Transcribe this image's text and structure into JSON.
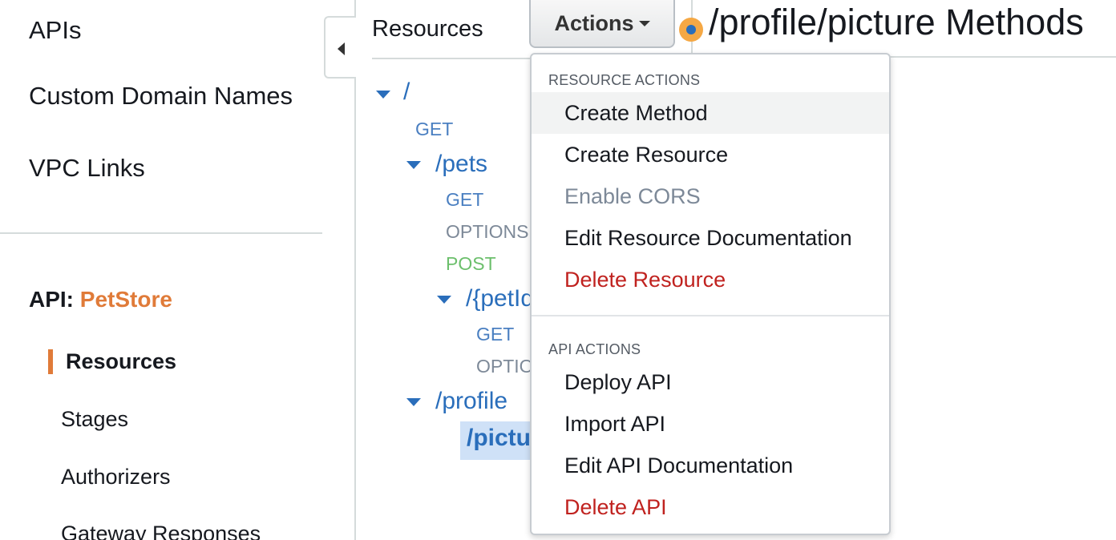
{
  "left_nav": {
    "top_items": [
      "APIs",
      "Custom Domain Names",
      "VPC Links"
    ],
    "api_label": "API:",
    "api_name": "PetStore",
    "sub_items": [
      "Resources",
      "Stages",
      "Authorizers",
      "Gateway Responses"
    ],
    "active_item": "Resources"
  },
  "resources_panel": {
    "title": "Resources",
    "tree": {
      "root": "/",
      "root_methods": [
        "GET"
      ],
      "pets": "/pets",
      "pets_methods": [
        "GET",
        "OPTIONS",
        "POST"
      ],
      "petid": "/{petId}",
      "petid_methods": [
        "GET",
        "OPTIONS"
      ],
      "profile": "/profile",
      "picture": "/picture"
    }
  },
  "actions_button": {
    "label": "Actions"
  },
  "page_header": {
    "title": "/profile/picture Methods"
  },
  "dropdown": {
    "resource_heading": "RESOURCE ACTIONS",
    "resource_actions": [
      "Create Method",
      "Create Resource",
      "Enable CORS",
      "Edit Resource Documentation",
      "Delete Resource"
    ],
    "api_heading": "API ACTIONS",
    "api_actions": [
      "Deploy API",
      "Import API",
      "Edit API Documentation",
      "Delete API"
    ]
  },
  "colors": {
    "accent": "#e07b39",
    "link": "#2a6ebb",
    "danger": "#c0221f",
    "post": "#6cbf6c"
  }
}
